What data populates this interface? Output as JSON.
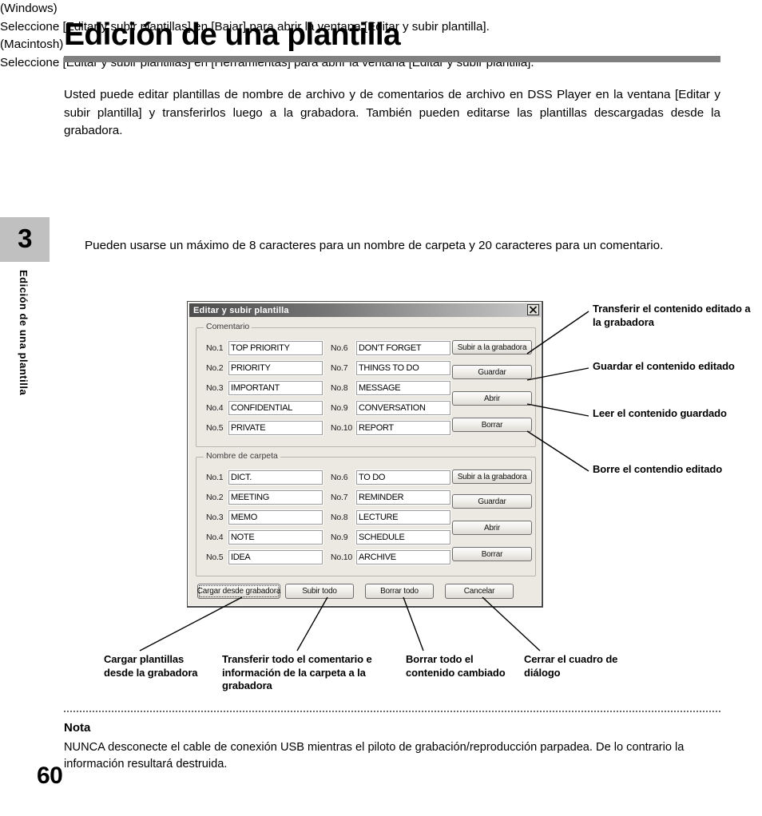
{
  "sidebar": {
    "chapter_number": "3",
    "chapter_title": "Edición de una plantilla",
    "page_number": "60"
  },
  "header": {
    "title": "Edición de una plantilla"
  },
  "body": {
    "intro": "Usted puede editar plantillas de nombre de archivo y de comentarios de archivo en DSS Player en la ventana [Editar y subir plantilla] y transferirlos luego a la grabadora. También pueden editarse las plantillas descargadas desde la grabadora.",
    "windows_heading": "(Windows)",
    "windows_text": "Seleccione [Editar y subir plantillas] en [Bajar] para abrir la ventana [Editar y subir plantilla].",
    "macintosh_heading": "(Macintosh)",
    "macintosh_text": "Seleccione [Editar y subir plantillas] en [Herramientas] para abrir la ventana [Editar y subir plantilla].",
    "limits_text": "Pueden usarse un máximo de 8 caracteres para un nombre de carpeta y 20 caracteres para un comentario."
  },
  "dialog": {
    "title": "Editar y subir plantilla",
    "close_icon": "close-icon",
    "comment_group": {
      "legend": "Comentario",
      "left_rows": [
        {
          "label": "No.1",
          "value": "TOP PRIORITY"
        },
        {
          "label": "No.2",
          "value": "PRIORITY"
        },
        {
          "label": "No.3",
          "value": "IMPORTANT"
        },
        {
          "label": "No.4",
          "value": "CONFIDENTIAL"
        },
        {
          "label": "No.5",
          "value": "PRIVATE"
        }
      ],
      "right_rows": [
        {
          "label": "No.6",
          "value": "DON'T FORGET"
        },
        {
          "label": "No.7",
          "value": "THINGS TO DO"
        },
        {
          "label": "No.8",
          "value": "MESSAGE"
        },
        {
          "label": "No.9",
          "value": "CONVERSATION"
        },
        {
          "label": "No.10",
          "value": "REPORT"
        }
      ],
      "buttons": [
        {
          "label": "Subir a la grabadora"
        },
        {
          "label": "Guardar"
        },
        {
          "label": "Abrir"
        },
        {
          "label": "Borrar"
        }
      ]
    },
    "folder_group": {
      "legend": "Nombre de carpeta",
      "left_rows": [
        {
          "label": "No.1",
          "value": "DICT."
        },
        {
          "label": "No.2",
          "value": "MEETING"
        },
        {
          "label": "No.3",
          "value": "MEMO"
        },
        {
          "label": "No.4",
          "value": "NOTE"
        },
        {
          "label": "No.5",
          "value": "IDEA"
        }
      ],
      "right_rows": [
        {
          "label": "No.6",
          "value": "TO DO"
        },
        {
          "label": "No.7",
          "value": "REMINDER"
        },
        {
          "label": "No.8",
          "value": "LECTURE"
        },
        {
          "label": "No.9",
          "value": "SCHEDULE"
        },
        {
          "label": "No.10",
          "value": "ARCHIVE"
        }
      ],
      "buttons": [
        {
          "label": "Subir a la grabadora"
        },
        {
          "label": "Guardar"
        },
        {
          "label": "Abrir"
        },
        {
          "label": "Borrar"
        }
      ]
    },
    "bottom_buttons": [
      {
        "label": "Cargar desde grabadora"
      },
      {
        "label": "Subir todo"
      },
      {
        "label": "Borrar todo"
      },
      {
        "label": "Cancelar"
      }
    ]
  },
  "callouts": {
    "right": [
      "Transferir el contenido editado a la grabadora",
      "Guardar el contenido editado",
      "Leer el contenido guardado",
      "Borre el contendio editado"
    ],
    "bottom": [
      "Cargar plantillas desde la grabadora",
      "Transferir todo el comentario e información de la carpeta a la grabadora",
      "Borrar todo el contenido cambiado",
      "Cerrar el cuadro de diálogo"
    ]
  },
  "note": {
    "title": "Nota",
    "text": "NUNCA desconecte el cable de conexión USB mientras el piloto de grabación/reproducción parpadea. De lo contrario la información resultará destruida."
  },
  "colors": {
    "rule": "#808080",
    "chapter_tab": "#c0c0c0",
    "dialog_face": "#ece9e3"
  }
}
